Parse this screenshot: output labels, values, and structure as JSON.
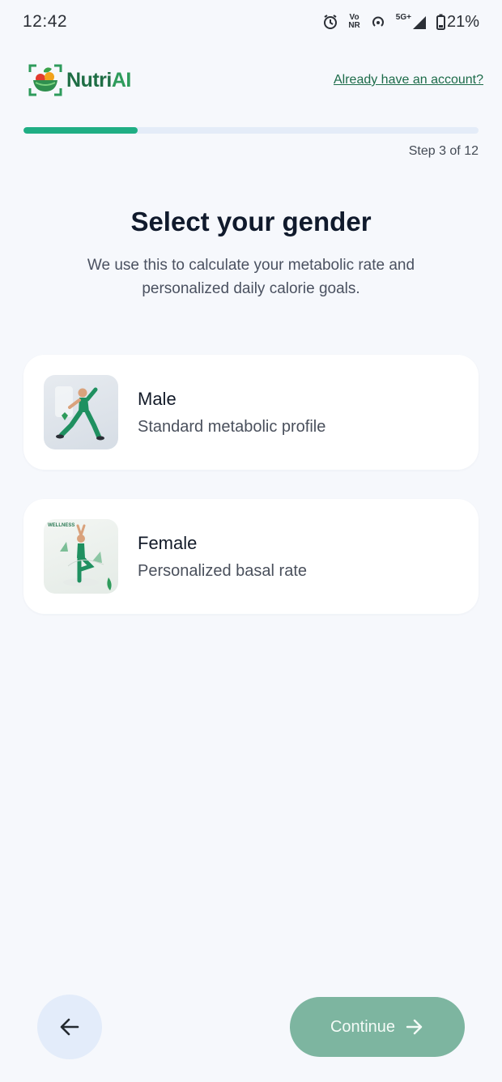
{
  "status_bar": {
    "time": "12:42",
    "network_label": "5G+",
    "volte_label_top": "Vo",
    "volte_label_bottom": "NR",
    "battery": "21%",
    "icons": [
      "alarm-icon",
      "volte-icon",
      "hotspot-icon",
      "signal-icon",
      "battery-icon"
    ]
  },
  "header": {
    "logo_text_main": "Nutri",
    "logo_text_accent": "AI",
    "signin_link": "Already have an account?"
  },
  "progress": {
    "step_label": "Step 3 of 12",
    "fraction": 0.25,
    "color": "#1fae84"
  },
  "main": {
    "title": "Select your gender",
    "subtitle": "We use this to calculate your metabolic rate and personalized daily calorie goals.",
    "options": [
      {
        "title": "Male",
        "description": "Standard metabolic profile",
        "image": "male-fitness-illustration"
      },
      {
        "title": "Female",
        "description": "Personalized basal rate",
        "image": "female-yoga-illustration",
        "image_tag": "WELLNESS"
      }
    ]
  },
  "footer": {
    "back_icon": "arrow-left-icon",
    "continue_label": "Continue",
    "continue_icon": "arrow-right-icon",
    "continue_color": "#7db5a0"
  }
}
